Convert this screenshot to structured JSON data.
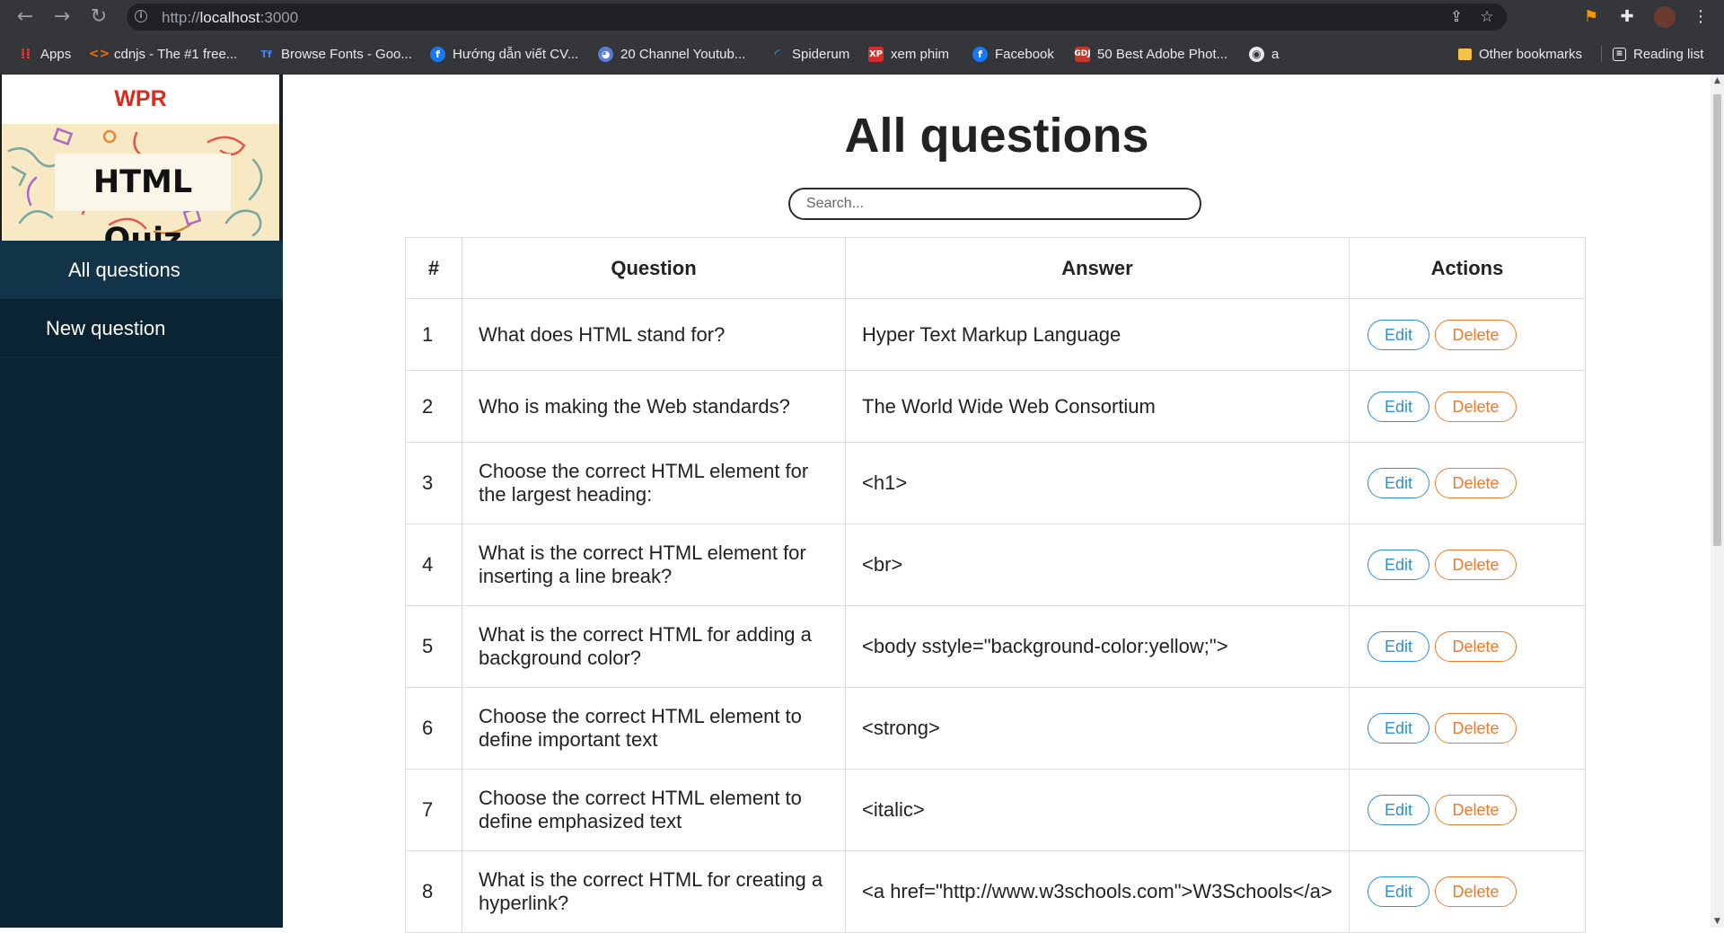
{
  "browser": {
    "url_scheme": "http://",
    "url_host": "localhost",
    "url_port": ":3000",
    "bookmarks": [
      {
        "label": "Apps",
        "icon": "apps-grid-icon",
        "color": "#ea4335"
      },
      {
        "label": "cdnjs - The #1 free...",
        "icon": "code-brackets-icon",
        "color": "#e8710a"
      },
      {
        "label": "Browse Fonts - Goo...",
        "icon": "google-fonts-icon",
        "color": "#4285f4"
      },
      {
        "label": "Hướng dẫn viết CV...",
        "icon": "facebook-icon",
        "color": "#1877f2"
      },
      {
        "label": "20 Channel Youtub...",
        "icon": "ghost-icon",
        "color": "#5b7bd5"
      },
      {
        "label": "Spiderum",
        "icon": "spiderum-icon",
        "color": "#2aa4ef"
      },
      {
        "label": "xem phim",
        "icon": "xp-icon",
        "color": "#d92b2b"
      },
      {
        "label": "Facebook",
        "icon": "facebook-icon",
        "color": "#1877f2"
      },
      {
        "label": "50 Best Adobe Phot...",
        "icon": "gdj-icon",
        "color": "#c0392b"
      },
      {
        "label": "a",
        "icon": "globe-icon",
        "color": "#9aa0a6"
      }
    ],
    "other_bookmarks": "Other bookmarks",
    "reading_list": "Reading list"
  },
  "sidebar": {
    "brand": "WPR",
    "banner_title": "HTML Quiz",
    "nav": [
      {
        "label": "All questions",
        "active": true
      },
      {
        "label": "New question",
        "active": false
      }
    ]
  },
  "main": {
    "title": "All questions",
    "search_placeholder": "Search...",
    "columns": [
      "#",
      "Question",
      "Answer",
      "Actions"
    ],
    "edit_label": "Edit",
    "delete_label": "Delete",
    "rows": [
      {
        "num": "1",
        "question": "What does HTML stand for?",
        "answer": "Hyper Text Markup Language"
      },
      {
        "num": "2",
        "question": "Who is making the Web standards?",
        "answer": "The World Wide Web Consortium"
      },
      {
        "num": "3",
        "question": "Choose the correct HTML element for the largest heading:",
        "answer": "<h1>"
      },
      {
        "num": "4",
        "question": "What is the correct HTML element for inserting a line break?",
        "answer": "<br>"
      },
      {
        "num": "5",
        "question": "What is the correct HTML for adding a background color?",
        "answer": "<body sstyle=\"background-color:yellow;\">"
      },
      {
        "num": "6",
        "question": "Choose the correct HTML element to define important text",
        "answer": "<strong>"
      },
      {
        "num": "7",
        "question": "Choose the correct HTML element to define emphasized text",
        "answer": "<italic>"
      },
      {
        "num": "8",
        "question": "What is the correct HTML for creating a hyperlink?",
        "answer": "<a href=\"http://www.w3schools.com\">W3Schools</a>"
      }
    ]
  },
  "colors": {
    "brand_red": "#e0291b",
    "sidebar_bg": "#0b2433",
    "edit_blue": "#2e8fd6",
    "delete_orange": "#ef7a2d"
  }
}
